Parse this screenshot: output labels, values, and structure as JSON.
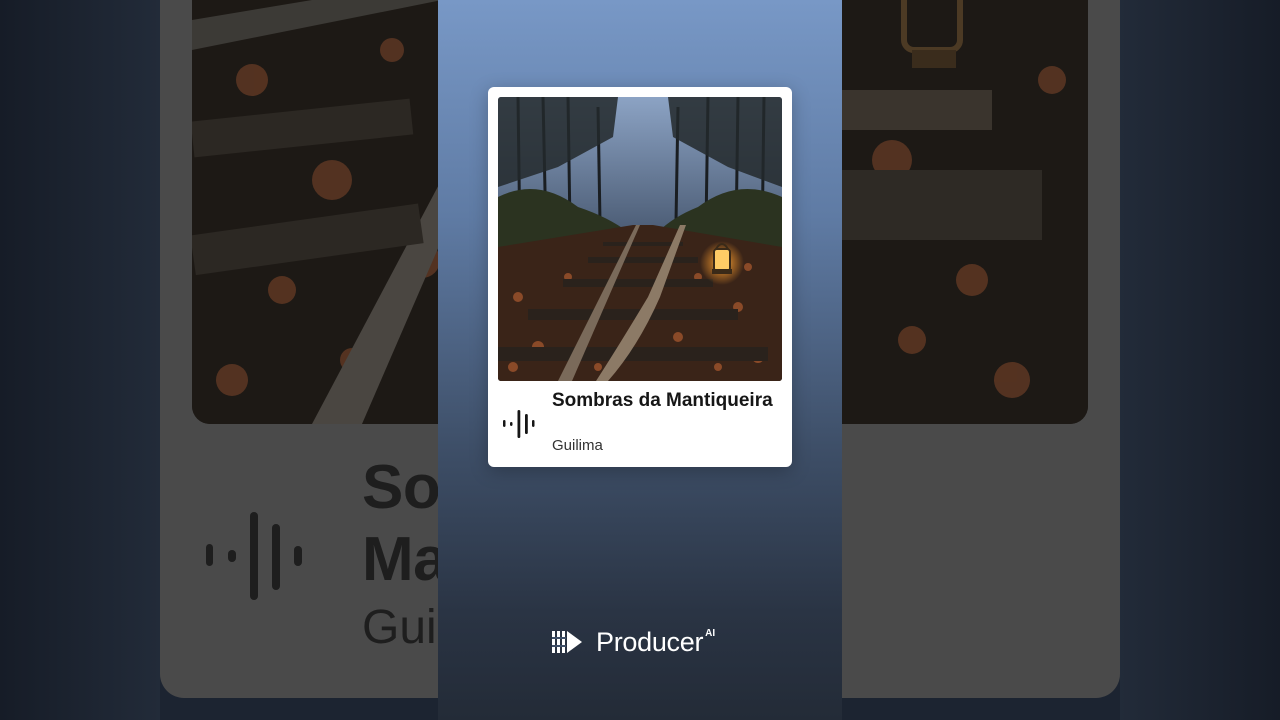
{
  "track": {
    "title": "Sombras da Mantiqueira",
    "artist": "Guilima",
    "cover_icon": "railway-lantern-artwork"
  },
  "background": {
    "title_partial": "So\nMa",
    "artist_partial": "Gui"
  },
  "brand": {
    "name": "Producer",
    "superscript": "AI",
    "logo_icon": "producer-logo-icon"
  },
  "icons": {
    "waveform": "audio-waveform-icon"
  },
  "colors": {
    "panel_top": "#7898c6",
    "panel_bottom": "#232b37",
    "card": "#ffffff",
    "text_dark": "#161616"
  }
}
